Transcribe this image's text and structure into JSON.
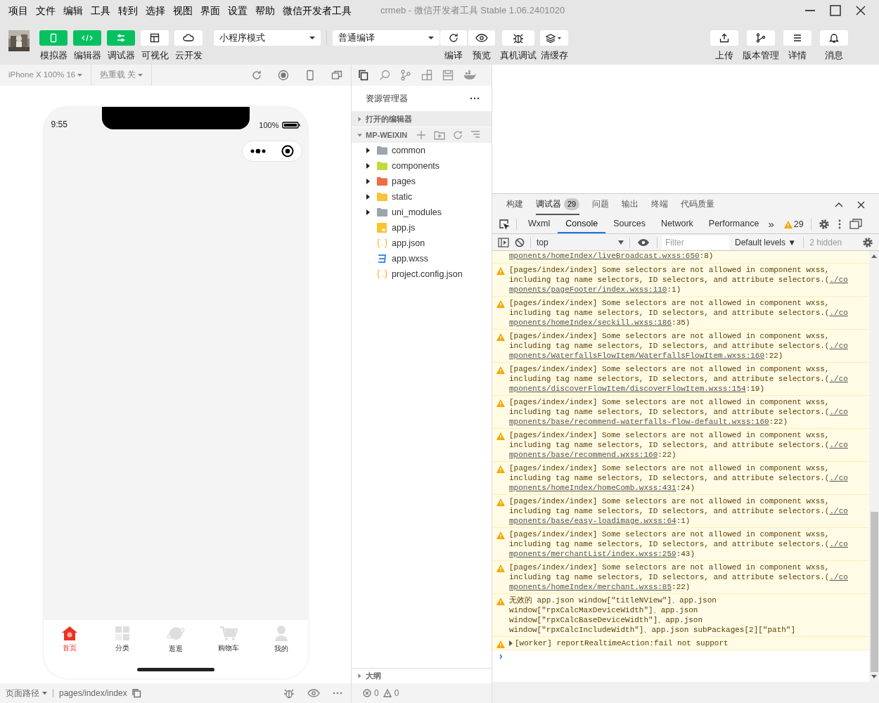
{
  "menu": [
    "项目",
    "文件",
    "编辑",
    "工具",
    "转到",
    "选择",
    "视图",
    "界面",
    "设置",
    "帮助",
    "微信开发者工具"
  ],
  "window": {
    "title": "crmeb - 微信开发者工具 Stable 1.06.2401020"
  },
  "toolbar": {
    "panel_toggles": [
      {
        "label": "模拟器",
        "on": true
      },
      {
        "label": "编辑器",
        "on": true
      },
      {
        "label": "调试器",
        "on": true
      },
      {
        "label": "可视化",
        "on": false
      },
      {
        "label": "云开发",
        "on": false
      }
    ],
    "mode_select": "小程序模式",
    "compile_select": "普通编译",
    "actions": [
      {
        "label": "编译"
      },
      {
        "label": "预览"
      },
      {
        "label": "真机调试"
      },
      {
        "label": "清缓存"
      }
    ],
    "right_actions": [
      {
        "label": "上传"
      },
      {
        "label": "版本管理"
      },
      {
        "label": "详情"
      },
      {
        "label": "消息"
      }
    ]
  },
  "simulator": {
    "device_select": "iPhone X 100% 16",
    "hot_reload_select": "热重载 关",
    "phone": {
      "time": "9:55",
      "battery": "100%",
      "tabs": [
        {
          "label": "首页",
          "selected": true
        },
        {
          "label": "分类",
          "selected": false
        },
        {
          "label": "逛逛",
          "selected": false
        },
        {
          "label": "购物车",
          "selected": false
        },
        {
          "label": "我的",
          "selected": false
        }
      ]
    },
    "status_bar": {
      "path_label": "页面路径",
      "path": "pages/index/index"
    }
  },
  "explorer": {
    "title": "资源管理器",
    "open_editors": "打开的编辑器",
    "project": "MP-WEIXIN",
    "items": [
      {
        "name": "common",
        "kind": "folder",
        "color": "#9aa5ad"
      },
      {
        "name": "components",
        "kind": "folder",
        "color": "#c5d93a"
      },
      {
        "name": "pages",
        "kind": "folder",
        "color": "#f06b46"
      },
      {
        "name": "static",
        "kind": "folder",
        "color": "#f8c23a"
      },
      {
        "name": "uni_modules",
        "kind": "folder",
        "color": "#9aa5ad"
      },
      {
        "name": "app.js",
        "kind": "script"
      },
      {
        "name": "app.json",
        "kind": "json"
      },
      {
        "name": "app.wxss",
        "kind": "style"
      },
      {
        "name": "project.config.json",
        "kind": "json"
      }
    ],
    "outline": "大纲",
    "errors": "0",
    "warnings": "0"
  },
  "devtools": {
    "tabs": [
      {
        "label": "构建",
        "selected": false
      },
      {
        "label": "调试器",
        "selected": true,
        "badge": "29"
      },
      {
        "label": "问题",
        "selected": false
      },
      {
        "label": "输出",
        "selected": false
      },
      {
        "label": "终端",
        "selected": false
      },
      {
        "label": "代码质量",
        "selected": false
      }
    ],
    "panels": [
      {
        "label": "Wxml",
        "selected": false
      },
      {
        "label": "Console",
        "selected": true
      },
      {
        "label": "Sources",
        "selected": false
      },
      {
        "label": "Network",
        "selected": false
      },
      {
        "label": "Performance",
        "selected": false
      }
    ],
    "more": "»",
    "warning_count": "29",
    "console_toolbar": {
      "context": "top",
      "filter_placeholder": "Filter",
      "levels": "Default levels ▼",
      "hidden": "2 hidden"
    },
    "partial_top": {
      "link_tail": "mponents/homeIndex/liveBroadcast.wxss:650",
      "suffix": ":8)"
    },
    "messages": [
      {
        "kind": "selector",
        "lines": [
          "[pages/index/index] Some selectors are not allowed in component wxss,",
          "including tag name selectors, ID selectors, and attribute selectors.("
        ],
        "link_head": "./co",
        "link_tail": "mponents/pageFooter/index.wxss:110",
        "suffix": ":1)"
      },
      {
        "kind": "selector",
        "lines": [
          "[pages/index/index] Some selectors are not allowed in component wxss,",
          "including tag name selectors, ID selectors, and attribute selectors.("
        ],
        "link_head": "./co",
        "link_tail": "mponents/homeIndex/seckill.wxss:186",
        "suffix": ":35)"
      },
      {
        "kind": "selector",
        "lines": [
          "[pages/index/index] Some selectors are not allowed in component wxss,",
          "including tag name selectors, ID selectors, and attribute selectors.("
        ],
        "link_head": "./co",
        "link_tail": "mponents/WaterfallsFlowItem/WaterfallsFlowItem.wxss:160",
        "suffix": ":22)"
      },
      {
        "kind": "selector",
        "lines": [
          "[pages/index/index] Some selectors are not allowed in component wxss,",
          "including tag name selectors, ID selectors, and attribute selectors.("
        ],
        "link_head": "./co",
        "link_tail": "mponents/discoverFlowItem/discoverFlowItem.wxss:154",
        "suffix": ":19)"
      },
      {
        "kind": "selector",
        "lines": [
          "[pages/index/index] Some selectors are not allowed in component wxss,",
          "including tag name selectors, ID selectors, and attribute selectors.("
        ],
        "link_head": "./co",
        "link_tail": "mponents/base/recommend-waterfalls-flow-default.wxss:160",
        "suffix": ":22)"
      },
      {
        "kind": "selector",
        "lines": [
          "[pages/index/index] Some selectors are not allowed in component wxss,",
          "including tag name selectors, ID selectors, and attribute selectors.("
        ],
        "link_head": "./co",
        "link_tail": "mponents/base/recommend.wxss:160",
        "suffix": ":22)"
      },
      {
        "kind": "selector",
        "lines": [
          "[pages/index/index] Some selectors are not allowed in component wxss,",
          "including tag name selectors, ID selectors, and attribute selectors.("
        ],
        "link_head": "./co",
        "link_tail": "mponents/homeIndex/homeComb.wxss:431",
        "suffix": ":24)"
      },
      {
        "kind": "selector",
        "lines": [
          "[pages/index/index] Some selectors are not allowed in component wxss,",
          "including tag name selectors, ID selectors, and attribute selectors.("
        ],
        "link_head": "./co",
        "link_tail": "mponents/base/easy-loadimage.wxss:64",
        "suffix": ":1)"
      },
      {
        "kind": "selector",
        "lines": [
          "[pages/index/index] Some selectors are not allowed in component wxss,",
          "including tag name selectors, ID selectors, and attribute selectors.("
        ],
        "link_head": "./co",
        "link_tail": "mponents/merchantList/index.wxss:259",
        "suffix": ":43)"
      },
      {
        "kind": "selector",
        "lines": [
          "[pages/index/index] Some selectors are not allowed in component wxss,",
          "including tag name selectors, ID selectors, and attribute selectors.("
        ],
        "link_head": "./co",
        "link_tail": "mponents/homeIndex/merchant.wxss:85",
        "suffix": ":22)"
      },
      {
        "kind": "plain",
        "lines": [
          "无效的 app.json window[\"titleNView\"]、app.json",
          "window[\"rpxCalcMaxDeviceWidth\"]、app.json",
          "window[\"rpxCalcBaseDeviceWidth\"]、app.json",
          "window[\"rpxCalcIncludeWidth\"]、app.json subPackages[2][\"path\"]"
        ]
      },
      {
        "kind": "collapsed",
        "lines": [
          "[worker] reportRealtimeAction:fail not support"
        ]
      }
    ],
    "prompt": "›"
  }
}
